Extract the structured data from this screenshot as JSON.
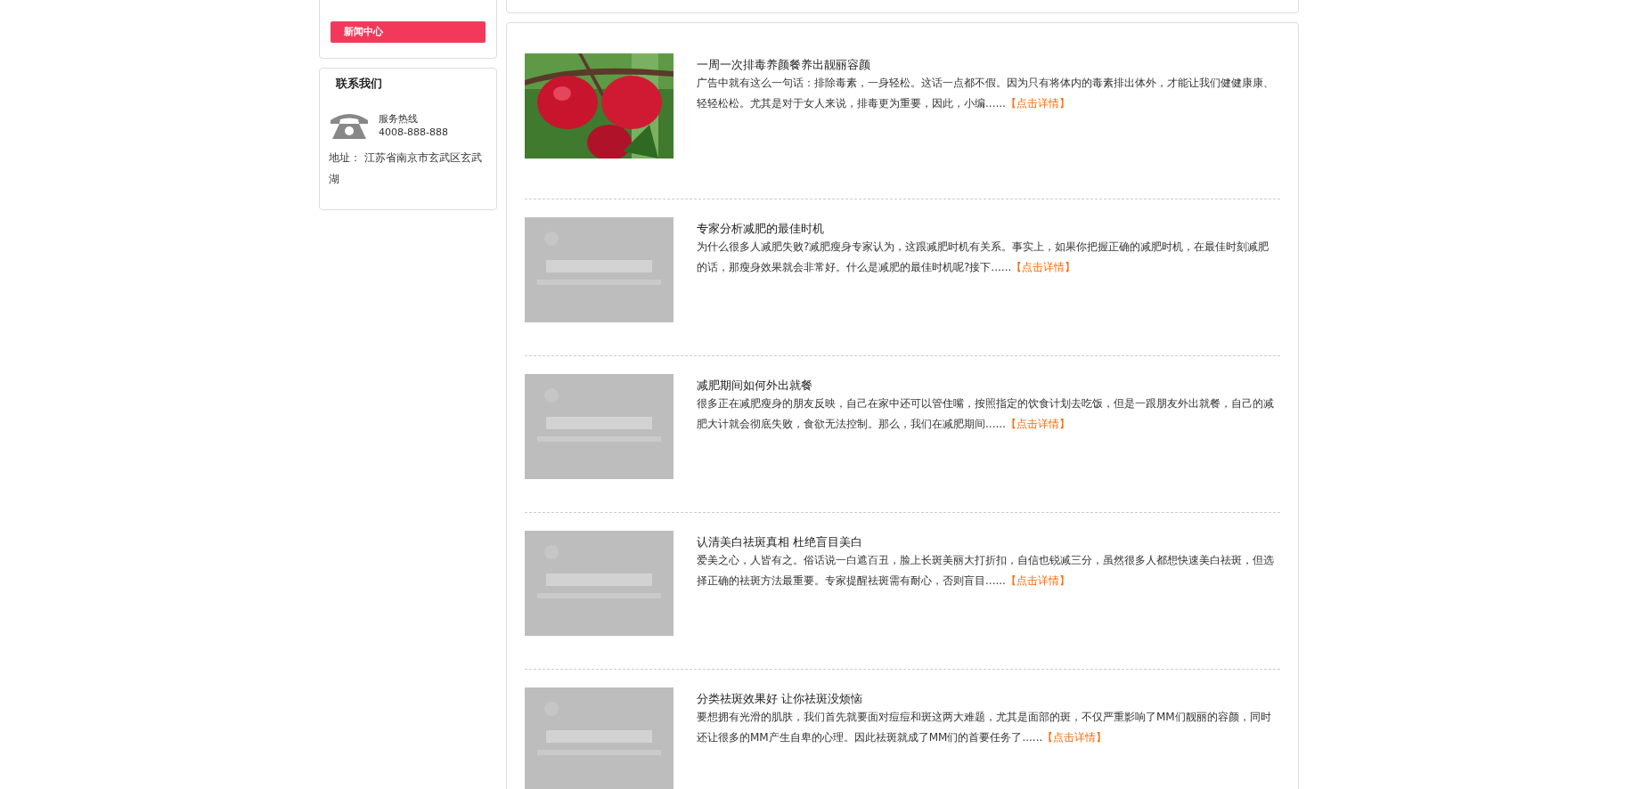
{
  "sidebar": {
    "nav_items": [
      {
        "label": "新闻中心",
        "selected": true
      }
    ],
    "contact": {
      "title": "联系我们",
      "hotline_label": "服务热线",
      "hotline": "4008-888-888",
      "address": "地址： 江苏省南京市玄武区玄武湖"
    }
  },
  "articles": [
    {
      "title": "一周一次排毒养颜餐养出靓丽容颜",
      "summary": "广告中就有这么一句话：排除毒素，一身轻松。这话一点都不假。因为只有将体内的毒素排出体外，才能让我们健健康康、轻轻松松。尤其是对于女人来说，排毒更为重要，因此，小编......",
      "link": "【点击详情】",
      "kind": "picture"
    },
    {
      "title": "专家分析减肥的最佳时机",
      "summary": "为什么很多人减肥失败?减肥瘦身专家认为，这跟减肥时机有关系。事实上，如果你把握正确的减肥时机，在最佳时刻减肥的话，那瘦身效果就会非常好。什么是减肥的最佳时机呢?接下......",
      "link": "【点击详情】",
      "kind": "picture"
    },
    {
      "title": "减肥期间如何外出就餐",
      "summary": "很多正在减肥瘦身的朋友反映，自己在家中还可以管住嘴，按照指定的饮食计划去吃饭，但是一跟朋友外出就餐，自己的减肥大计就会彻底失败，食欲无法控制。那么，我们在减肥期间......",
      "link": "【点击详情】",
      "kind": "picture"
    },
    {
      "title": "认清美白祛斑真相 杜绝盲目美白",
      "summary": "爱美之心，人皆有之。俗话说一白遮百丑，脸上长斑美丽大打折扣，自信也锐减三分，虽然很多人都想快速美白祛斑，但选择正确的祛斑方法最重要。专家提醒祛斑需有耐心，否则盲目......",
      "link": "【点击详情】",
      "kind": "picture"
    },
    {
      "title": "分类祛斑效果好 让你祛斑没烦恼",
      "summary": "要想拥有光滑的肌肤，我们首先就要面对痘痘和斑这两大难题，尤其是面部的斑，不仅严重影响了MM们靓丽的容颜，同时还让很多的MM产生自卑的心理。因此祛斑就成了MM们的首要任务了......",
      "link": "【点击详情】",
      "kind": "picture"
    }
  ]
}
